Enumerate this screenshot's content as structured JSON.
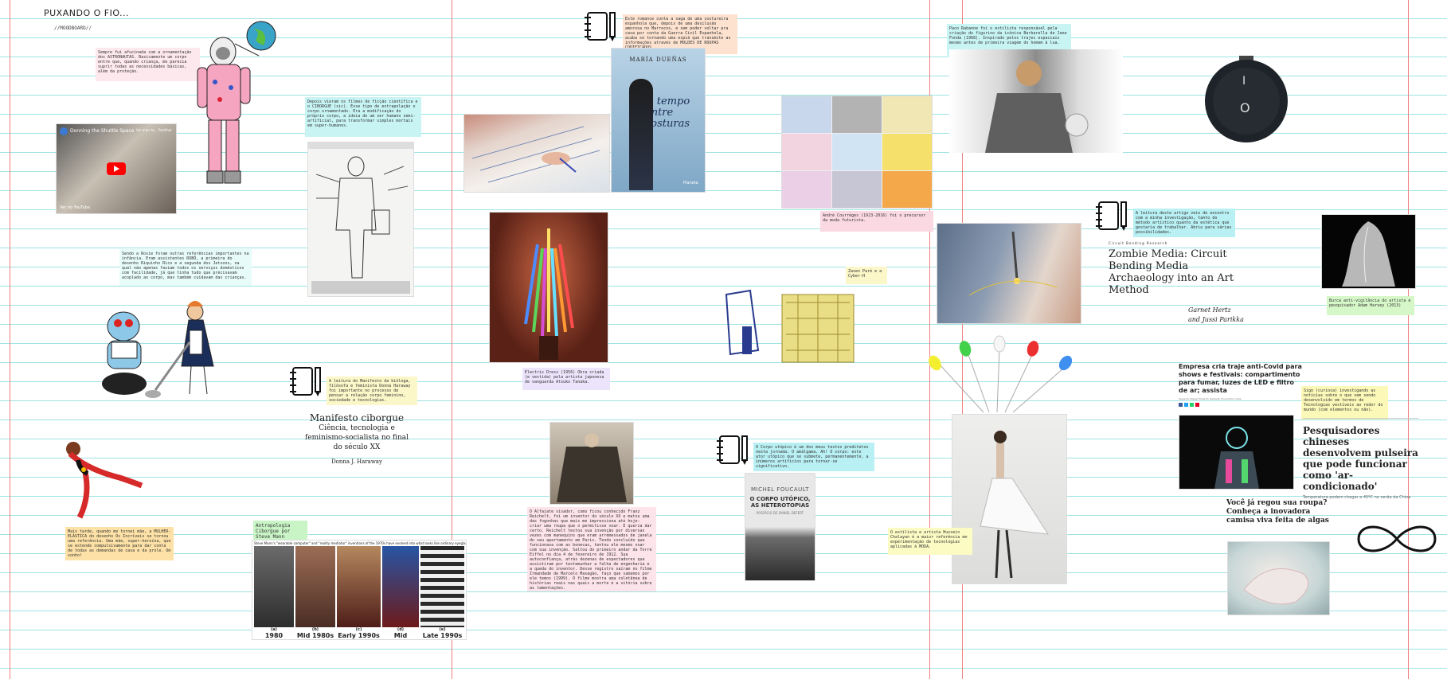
{
  "board": {
    "title": "PUXANDO O FIO...",
    "subtitle": "//MOODBOARD//"
  },
  "video": {
    "title": "Donning the Shuttle Space ...",
    "watch_later": "Ver mais ta...",
    "share": "Partilhar",
    "footer": "Ver no YouTube"
  },
  "notes": {
    "astronaut": "Sempre fui afucinada com a ornamentação dos ASTRONAUTAS. Basicamente um corpo entre que, quando criança, me parecia suprir todas as necessidades básicas, além da proteção.",
    "cyborg_films": "Depois vieram os filmes de ficção científica e o CIBORGUE (sic). Esse tipo de extrapolação o corpo ornamentado. Era a modificação do próprio corpo, a ideia de um ser humano semi-artificial, para transformar simples mortais em super-humanos.",
    "rosie": "Sendo a Rosie foram outras referências importantes na infância. Eram assistentes ROBÔ, a primeira do desenho Riquinho Rico e a segunda dos Jetsons, na qual não apenas faziam todos os serviços domésticos com facilidade, já que tinha tudo que precisavam acoplado ao corpo, mas também cuidavam das crianças.",
    "manifesto": "A leitura do Manifesto da bióloga, filósofa e feminista Donna Haraway foi importante no processo de pensar a relação corpo feminino, sociedade e tecnologias.",
    "elastic": "Mais tarde, quando me tornei mãe, a MULHER-ELÁSTICA do desenho Os Incríveis se tornou uma referência. Uma mãe, super-heroína, que se estende compulsivamente para dar conta de todas as demandas de casa e da prole. Um sonho!",
    "mann": "Antropologia Ciborgue por Steve Mann",
    "novel": "Este romance conta a saga de uma costureira espanhola que, depois de uma desilusão amorosa no Marrocos, e sem poder voltar pra casa por conta da Guerra Civil Espanhola, acaba se tornando uma espiã que transmite as informações através de MOLDES DE ROUPAS CODIFICADOS.",
    "tanaka": "Electric Dress (1956) Obra criada (e vestida) pela artista japonesa de vanguarda Atsuko Tanaka.",
    "ashcroft": "O Alfaiate visador, como ficou conhecido Franz Reichelt, foi um inventor do século XX e matou uma das fogonhas que mais me impressiona até hoje: criar uma roupa que o permitisse voar. E queria dar certo. Reichelt testou sua invenção por diversas vezes com manequins que eram arremessados de janela do seu apartamento em Paris. Tendo concluído que funcionava com as bonecas, tentou ele mesmo voar com sua invenção. Saltou do primeiro andar da Torre Eiffel no dia 4 de fevereiro de 1912. Sua autoconfiança, atrás dezenas de espectadores que assistiram por testemunhar a falha de engenharia e a queda do inventor. Desse registro saíram no filme Irmandade de Marcelo Masagão, faço que sabemos por ele temos (1999). O filme mostra uma coletânea de histórias reais nas quais a morte é a vitória sobre as lamentações.",
    "courreges": "André Courrèges (1923-2016) foi o precursor da moda futurista.",
    "zaven": "Zaven Paré e a Cyber-H",
    "foucault": "O Corpo utópico é um dos meus textos preditetos nesta jornada. O amálgama. Ah! O corpo: este ator utópico que se submete, permanentemente, a inúmeros artifícios para tornar-se significativo.",
    "rabanne": "Paco Rabanne foi o estilista responsável pela criação do figurino da icônica Barbarella de Jane Fonda (1968). Inspirado pelos trajes espaciais mesmo antes de primeira viagem do homem à lua.",
    "circuit": "A leitura deste artigo veio de encontro com a minha investigação, tanto do método artístico quanto da estética que gostaria de trabalhar. Abriu para várias possibilidades.",
    "burqa": "Burca anti-vigilância do artista e pesquisador Adam Harvey (2013)",
    "chalayan": "O estilista e artista Hussein Chalayan é a maior referência em experimentação de tecnologias aplicadas à MODA.",
    "sigo": "Sigo (curiosa) investigando as notícias sobre o que vem sendo desenvolvido em termos de Tecnologias vestíveis ao redor do mundo (com elementos ou não)."
  },
  "book_manifesto": {
    "title": "Manifesto ciborgue",
    "subtitle": "Ciência, tecnologia e feminismo-socialista no final do século XX",
    "author": "Donna J. Haraway"
  },
  "book_novel": {
    "author": "MARÍA DUEÑAS",
    "title": "O tempo entre costuras",
    "publisher": "Planeta"
  },
  "book_foucault": {
    "author": "MICHEL FOUCAULT",
    "title": "O CORPO UTÓPICO, AS HETEROTOPIAS",
    "note": "POSFÁCIO DE DANIEL DEFERT"
  },
  "article_zombie": {
    "kicker": "Circuit Bending Research",
    "title": "Zombie Media: Circuit Bending Media Archaeology into an Art Method",
    "authors": "Garnet Hertz and Jussi Parikka"
  },
  "news_covid": {
    "headline": "Empresa cria traje anti-Covid para shows e festivais: compartimento para fumar, luzes de LED e filtro de ar; assista",
    "meta": "Segundo Miguel Eduardo, Redação Productions Ltda."
  },
  "news_bracelet": {
    "headline": "Pesquisadores chineses desenvolvem pulseira que pode funcionar como 'ar-condicionado'",
    "dek": "Temperatura podem chegar a 45ºC no verão da China"
  },
  "news_algae": {
    "headline": "Você já regou sua roupa? Conheça a inovadora camisa viva feita de algas"
  },
  "mann_strip": {
    "header": "Steve Mann's \"wearable computer\" and \"reality mediator\" inventions of the 1970s have evolved into what looks like ordinary eyeglasses",
    "panels": [
      {
        "letter": "(a)",
        "year": "1980"
      },
      {
        "letter": "(b)",
        "year": "Mid 1980s"
      },
      {
        "letter": "(c)",
        "year": "Early 1990s"
      },
      {
        "letter": "(d)",
        "year": "Mid 1990s"
      },
      {
        "letter": "(e)",
        "year": "Late 1990s"
      }
    ]
  },
  "switch": {
    "top": "I",
    "bottom": "O"
  },
  "colors": {
    "grid_line": "#9fe3e3",
    "margin_line": "#f08080",
    "youtube_red": "#ff0000"
  }
}
